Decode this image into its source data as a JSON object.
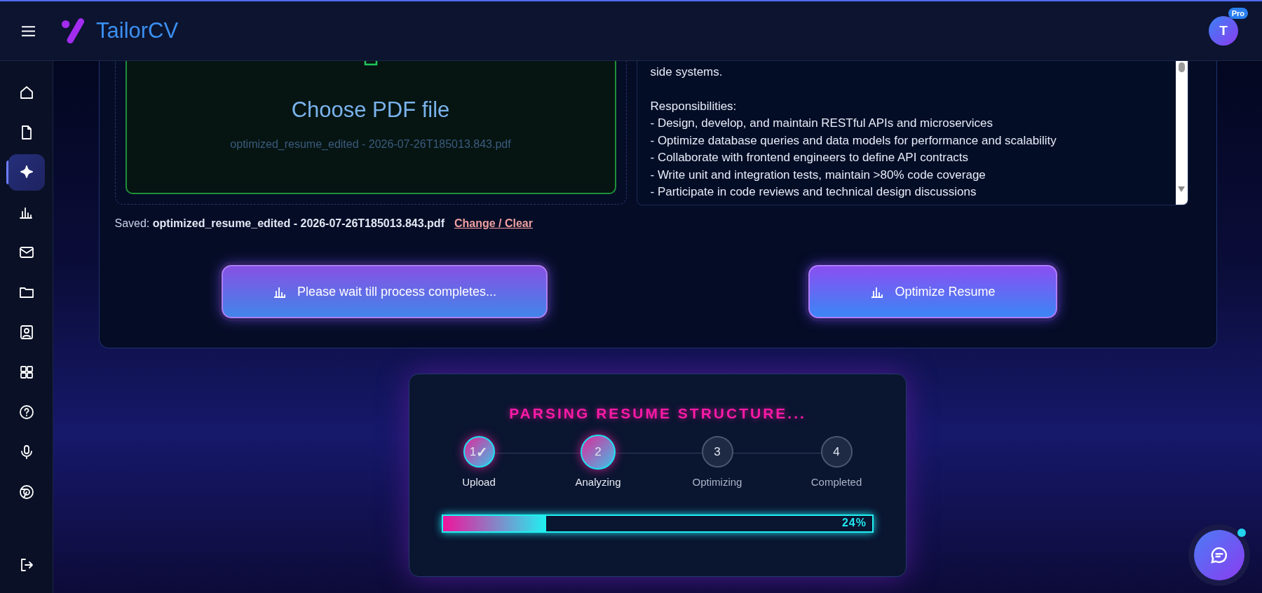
{
  "header": {
    "brand": "TailorCV",
    "avatar_initial": "T",
    "plan_badge": "Pro"
  },
  "sidebar": {
    "items": [
      {
        "selected": false
      },
      {
        "selected": false
      },
      {
        "selected": true
      },
      {
        "selected": false
      },
      {
        "selected": false
      },
      {
        "selected": false
      },
      {
        "selected": false
      },
      {
        "selected": false
      },
      {
        "selected": false
      },
      {
        "selected": false
      },
      {
        "selected": false
      }
    ]
  },
  "upload": {
    "title": "Choose PDF file",
    "file_name": "optimized_resume_edited - 2026-07-26T185013.843.pdf"
  },
  "saved": {
    "label": "Saved:",
    "file_name": "optimized_resume_edited - 2026-07-26T185013.843.pdf",
    "link": "Change / Clear"
  },
  "job_description": {
    "paragraphs": [
      [
        "side systems."
      ],
      [
        "Responsibilities:",
        "- Design, develop, and maintain RESTful APIs and microservices",
        "- Optimize database queries and data models for performance and scalability",
        "- Collaborate with frontend engineers to define API contracts",
        "- Write unit and integration tests, maintain >80% code coverage",
        "- Participate in code reviews and technical design discussions"
      ]
    ]
  },
  "buttons": [
    {
      "label": "Please wait till process completes...",
      "disabled": true
    },
    {
      "label": "Optimize Resume",
      "disabled": false
    }
  ],
  "progress": {
    "title": "PARSING RESUME STRUCTURE...",
    "steps": [
      {
        "number": "1",
        "check": "✓",
        "label": "Upload",
        "completed": true,
        "current": false
      },
      {
        "number": "2",
        "label": "Analyzing",
        "completed": false,
        "current": true
      },
      {
        "number": "3",
        "label": "Optimizing",
        "completed": false,
        "current": false
      },
      {
        "number": "4",
        "label": "Completed",
        "completed": false,
        "current": false
      }
    ],
    "level": 0.24,
    "reading": "24%"
  },
  "chat": {
    "online": true
  }
}
